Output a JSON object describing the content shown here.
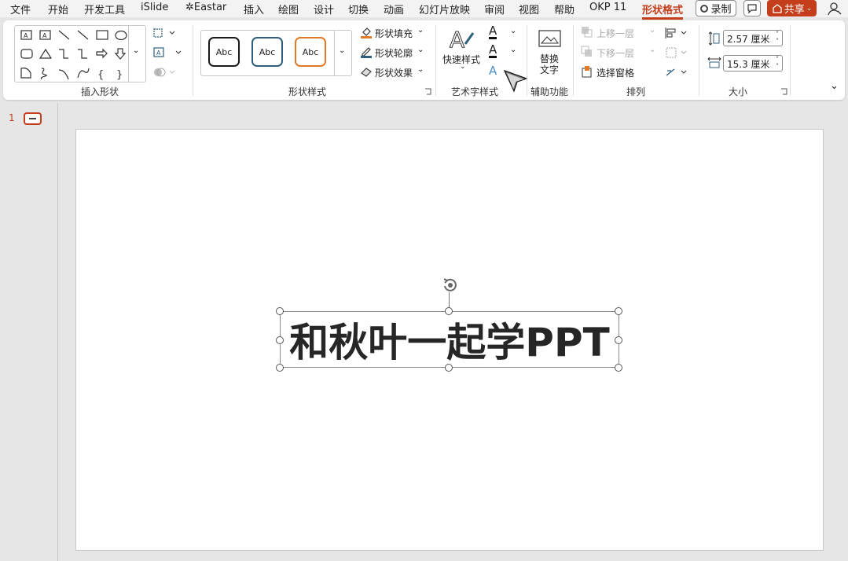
{
  "menu": {
    "tabs": [
      "文件",
      "开始",
      "开发工具",
      "iSlide",
      "Eastar",
      "插入",
      "绘图",
      "设计",
      "切换",
      "动画",
      "幻灯片放映",
      "审阅",
      "视图",
      "帮助",
      "OKP 11",
      "形状格式"
    ],
    "record_label": "录制",
    "share_label": "共享"
  },
  "ribbon": {
    "insert_shapes_label": "插入形状",
    "shape_styles_label": "形状样式",
    "style_preset_text": "Abc",
    "shape_fill": "形状填充",
    "shape_outline": "形状轮廓",
    "shape_effects": "形状效果",
    "quick_styles": "快速样式",
    "wordart_label": "艺术字样式",
    "alt_text_line1": "替换",
    "alt_text_line2": "文字",
    "accessibility_label": "辅助功能",
    "bring_forward": "上移一层",
    "send_backward": "下移一层",
    "selection_pane": "选择窗格",
    "arrange_label": "排列",
    "height_value": "2.57 厘米",
    "width_value": "15.3 厘米",
    "size_label": "大小"
  },
  "slides": {
    "current_number": "1"
  },
  "slide": {
    "title_text": "和秋叶一起学PPT"
  },
  "colors": {
    "accent": "#c43e1c",
    "preset_black": "#1a1a1a",
    "preset_blue": "#2f5f7f",
    "preset_orange": "#e07a2a"
  }
}
